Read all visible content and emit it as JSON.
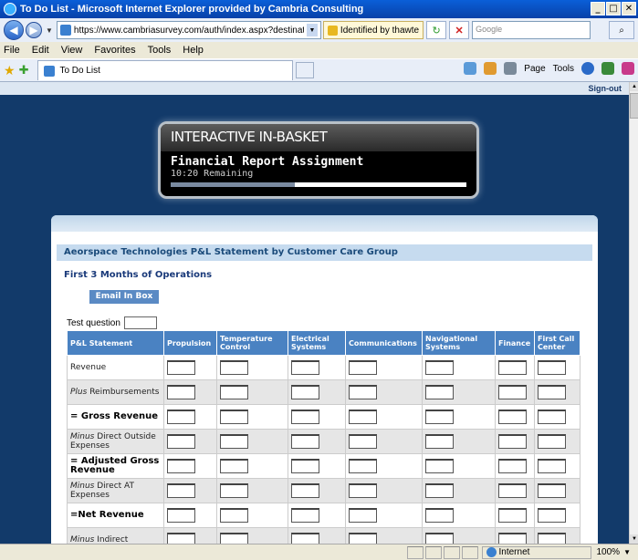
{
  "window": {
    "title": "To Do List - Microsoft Internet Explorer provided by Cambria Consulting"
  },
  "nav": {
    "url": "https://www.cambriasurvey.com/auth/index.aspx?destinatior",
    "security": "Identified by thawte",
    "search_placeholder": "Google"
  },
  "menu": [
    "File",
    "Edit",
    "View",
    "Favorites",
    "Tools",
    "Help"
  ],
  "tab": {
    "label": "To Do List"
  },
  "tools": {
    "page": "Page",
    "tools": "Tools"
  },
  "signout": "Sign-out",
  "badge": {
    "header": "INTERACTIVE IN-BASKET",
    "title": "Financial Report Assignment",
    "time": "10:20 Remaining",
    "progress_fraction": 0.42
  },
  "panel": {
    "section_title": "Aeorspace Technologies P&L Statement by Customer Care Group",
    "subtitle": "First 3 Months of Operations",
    "email_button": "Email In Box",
    "test_question": "Test question"
  },
  "table": {
    "headers": [
      "P&L Statement",
      "Propulsion",
      "Temperature Control",
      "Electrical Systems",
      "Communications",
      "Navigational Systems",
      "Finance",
      "First Call Center"
    ],
    "rows": [
      {
        "prefix": "",
        "label": "Revenue",
        "bold": false
      },
      {
        "prefix": "Plus",
        "label": "Reimbursements",
        "bold": false
      },
      {
        "prefix": "",
        "label": "= Gross Revenue",
        "bold": true
      },
      {
        "prefix": "Minus",
        "label": "Direct Outside Expenses",
        "bold": false
      },
      {
        "prefix": "",
        "label": "= Adjusted Gross Revenue",
        "bold": true
      },
      {
        "prefix": "Minus",
        "label": "Direct AT Expenses",
        "bold": false
      },
      {
        "prefix": "",
        "label": "=Net Revenue",
        "bold": true
      },
      {
        "prefix": "Minus",
        "label": "Indirect",
        "bold": false
      }
    ]
  },
  "status": {
    "zone": "Internet",
    "zoom": "100%"
  }
}
